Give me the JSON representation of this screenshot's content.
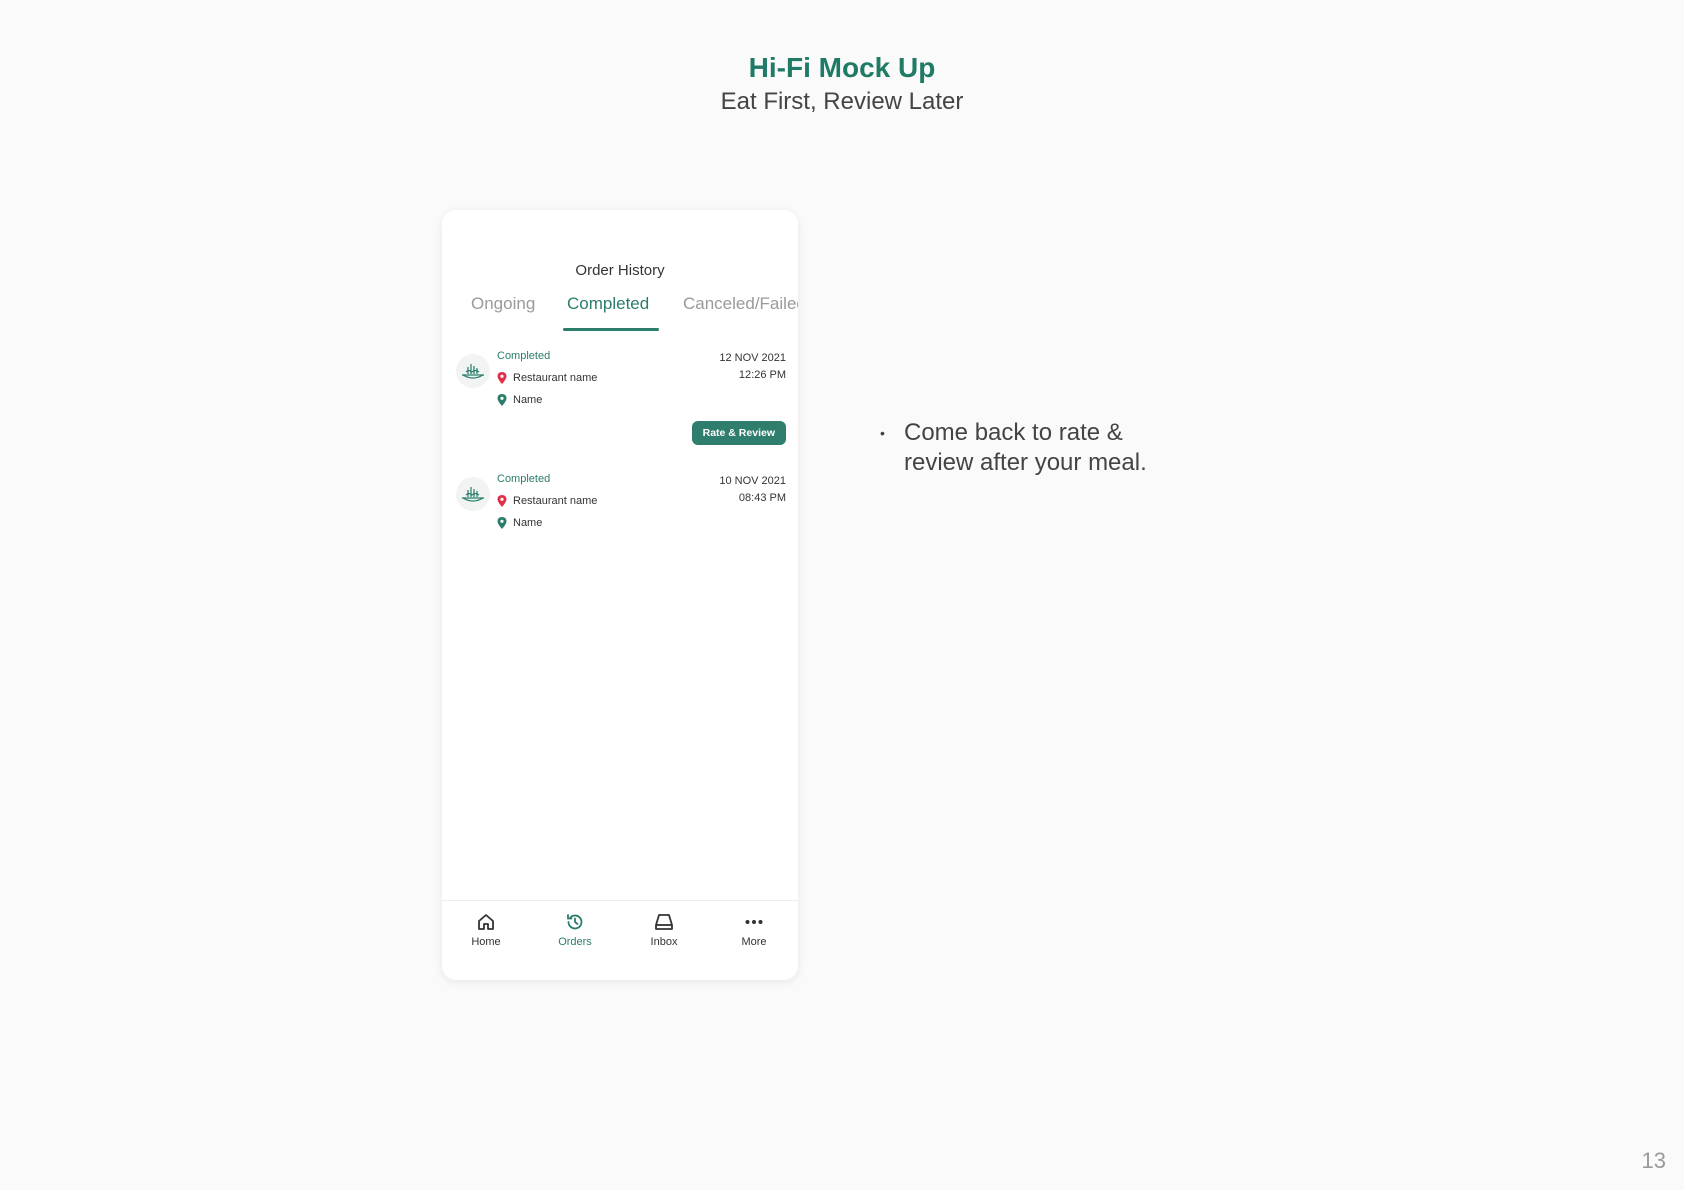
{
  "slide": {
    "title": "Hi-Fi Mock Up",
    "subtitle": "Eat First, Review Later",
    "page_number": "13",
    "note_bullet": "•",
    "note": "Come back to rate & review after your meal."
  },
  "screen": {
    "title": "Order History",
    "tabs": [
      {
        "label": "Ongoing",
        "active": false
      },
      {
        "label": "Completed",
        "active": true
      },
      {
        "label": "Canceled/Failed",
        "active": false
      }
    ],
    "orders": [
      {
        "status": "Completed",
        "restaurant": "Restaurant name",
        "name": "Name",
        "date": "12 NOV 2021",
        "time": "12:26 PM",
        "action": "Rate & Review"
      },
      {
        "status": "Completed",
        "restaurant": "Restaurant name",
        "name": "Name",
        "date": "10 NOV 2021",
        "time": "08:43 PM"
      }
    ],
    "nav": [
      {
        "label": "Home",
        "icon": "home-icon",
        "active": false
      },
      {
        "label": "Orders",
        "icon": "history-icon",
        "active": true
      },
      {
        "label": "Inbox",
        "icon": "inbox-icon",
        "active": false
      },
      {
        "label": "More",
        "icon": "more-icon",
        "active": false
      }
    ]
  },
  "colors": {
    "accent": "#2a7d6b",
    "title": "#1f7a66",
    "restaurant_pin": "#e0304a",
    "name_pin": "#2a7d6b"
  }
}
